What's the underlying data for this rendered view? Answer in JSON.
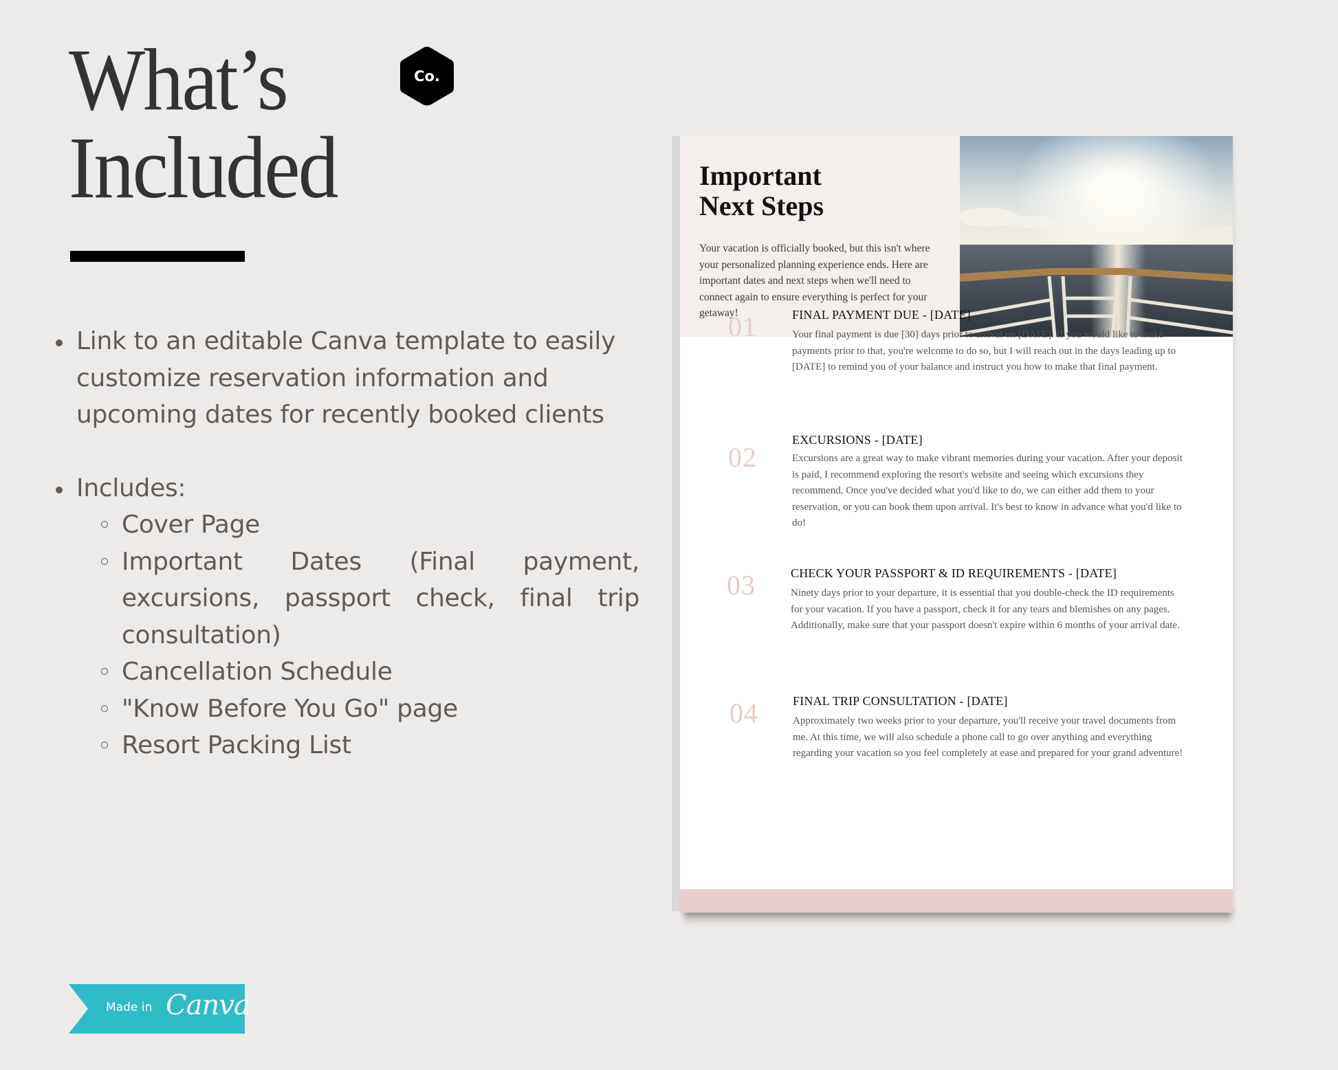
{
  "heading": {
    "line1": "What’s",
    "line2": "Included"
  },
  "brand_badge": {
    "label": "Co.",
    "icon": "hexagon-logo-icon"
  },
  "features": [
    {
      "text": "Link to an editable Canva template to easily customize reservation information and upcoming dates for recently booked clients"
    },
    {
      "text": "Includes:",
      "sub_items": [
        "Cover Page",
        "Important Dates (Final payment, excursions, passport check, final trip consultation)",
        "Cancellation Schedule",
        "\"Know Before You Go\" page",
        "Resort Packing List"
      ]
    }
  ],
  "canva_badge": {
    "prefix": "Made in",
    "brand": "Canva",
    "color": "#2dbcc8"
  },
  "document": {
    "title_line1": "Important",
    "title_line2": "Next Steps",
    "intro": "Your vacation is officially booked, but this isn't where your personalized planning experience ends. Here are important dates and next steps when we'll need to connect again to ensure everything is perfect for your getaway!",
    "photo": "sunlit-ocean-ship-railing",
    "accent_color": "#e8ceca",
    "steps": [
      {
        "number": "01",
        "title": "FINAL PAYMENT DUE - [DATE]",
        "body": "Your final payment is due [30] days prior to arrival on [DATE]. If you would like to make payments prior to that, you're welcome to do so, but I will reach out in the days leading up to [DATE] to remind you of your balance and instruct you how to make that final payment."
      },
      {
        "number": "02",
        "title": "EXCURSIONS - [DATE]",
        "body": "Excursions are a great way to make vibrant memories during your vacation. After your deposit is paid, I recommend exploring the resort's website and seeing which excursions they recommend. Once you've decided what you'd like to do, we can either add them to your reservation, or you can book them upon arrival. It's best to know in advance what you'd like to do!"
      },
      {
        "number": "03",
        "title": "CHECK YOUR PASSPORT & ID REQUIREMENTS -  [DATE]",
        "body": "Ninety days prior to your departure, it is essential that you double-check the ID requirements for your vacation. If you have a passport, check it for any tears and blemishes on any pages. Additionally, make sure that your passport doesn't expire within 6 months of your arrival date."
      },
      {
        "number": "04",
        "title": "FINAL TRIP CONSULTATION - [DATE]",
        "body": "Approximately two weeks prior to your departure, you'll receive your travel documents from me. At this time, we will also schedule a phone call to go over anything and everything regarding your vacation so you feel completely at ease and prepared for your grand adventure!"
      }
    ]
  }
}
